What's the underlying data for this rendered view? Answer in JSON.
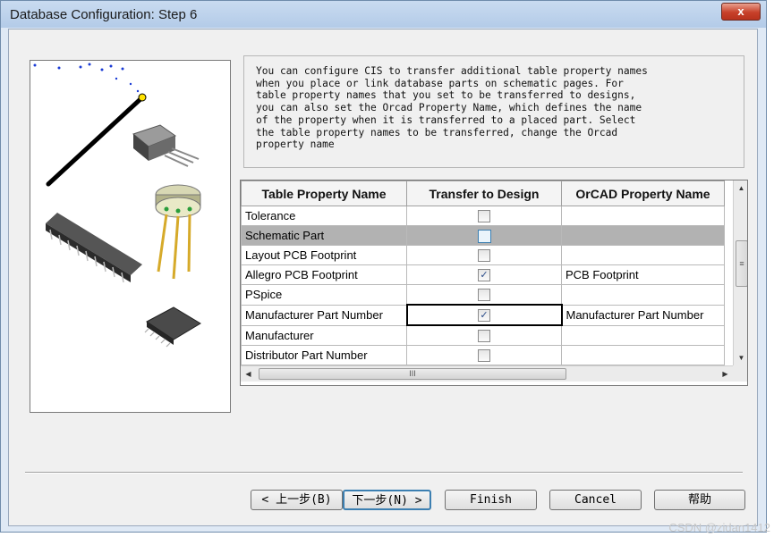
{
  "window": {
    "title": "Database Configuration: Step 6",
    "close_label": "x"
  },
  "description": {
    "text": "You can configure CIS to transfer additional table property names\nwhen you place or link database parts on schematic pages. For\ntable property names that you set to be transferred to designs,\nyou can also set the Orcad Property Name, which defines the name\nof the property when it is transferred to a placed part. Select\nthe table property names to be transferred, change the Orcad\nproperty name"
  },
  "grid": {
    "headers": [
      "Table Property Name",
      "Transfer to Design",
      "OrCAD Property Name"
    ],
    "rows": [
      {
        "name": "Tolerance",
        "transfer": false,
        "orcad": ""
      },
      {
        "name": "Schematic Part",
        "transfer": false,
        "orcad": ""
      },
      {
        "name": "Layout PCB Footprint",
        "transfer": false,
        "orcad": ""
      },
      {
        "name": "Allegro PCB Footprint",
        "transfer": true,
        "orcad": "PCB Footprint"
      },
      {
        "name": "PSpice",
        "transfer": false,
        "orcad": ""
      },
      {
        "name": "Manufacturer Part Number",
        "transfer": true,
        "orcad": "Manufacturer Part Number"
      },
      {
        "name": "Manufacturer",
        "transfer": false,
        "orcad": ""
      },
      {
        "name": "Distributor Part Number",
        "transfer": false,
        "orcad": ""
      }
    ],
    "selected_row": 1,
    "scroll_up": "▲",
    "scroll_down": "▼",
    "scroll_left": "◀",
    "scroll_right": "▶",
    "vthumb_grip": "≡",
    "hthumb_grip": "III"
  },
  "buttons": {
    "back": "< 上一步(B)",
    "next": "下一步(N) >",
    "finish": "Finish",
    "cancel": "Cancel",
    "help": "帮助"
  },
  "watermark": "CSDN @zidan1412",
  "colors": {
    "title_bar": "#c9dbf0",
    "dialog_bg": "#f0f0f0",
    "selected_row": "#b2b2b2",
    "focus_border": "#3c7fb1"
  }
}
